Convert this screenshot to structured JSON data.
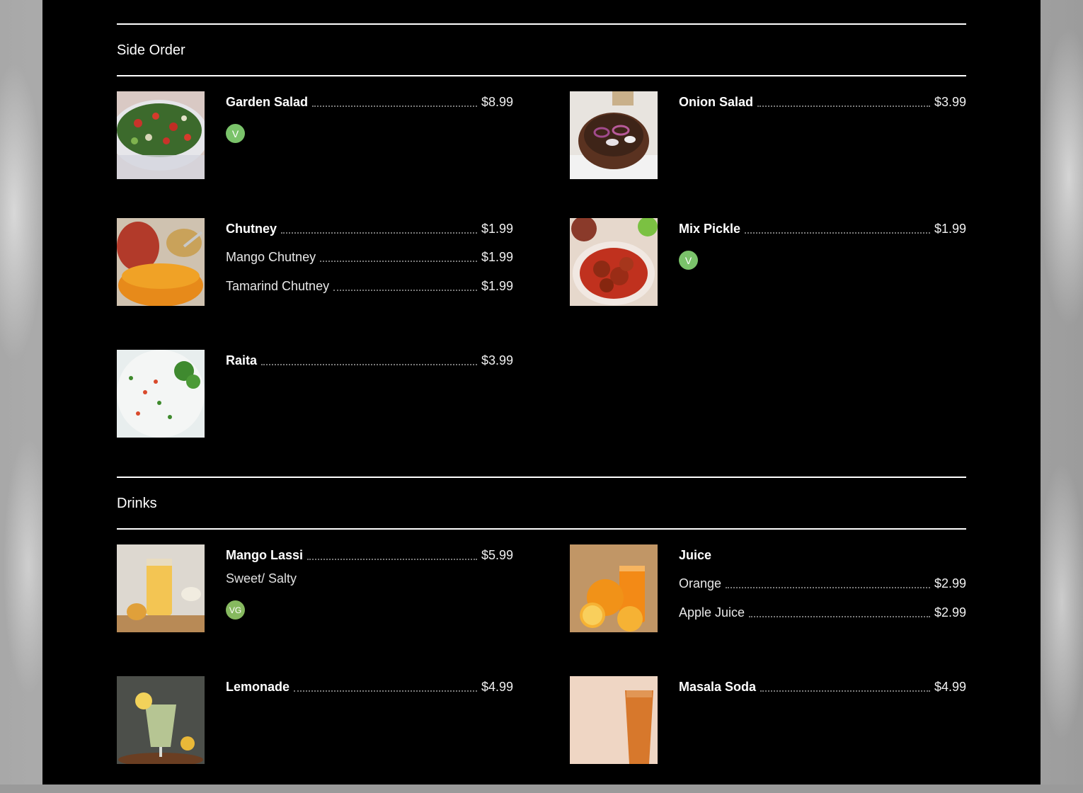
{
  "sections": [
    {
      "title": "Side Order",
      "items": [
        {
          "name": "Garden Salad",
          "price": "$8.99",
          "badge": "V"
        },
        {
          "name": "Onion Salad",
          "price": "$3.99"
        },
        {
          "name": "Chutney",
          "price": "$1.99",
          "options": [
            {
              "name": "Mango Chutney",
              "price": "$1.99"
            },
            {
              "name": "Tamarind Chutney",
              "price": "$1.99"
            }
          ]
        },
        {
          "name": "Mix Pickle",
          "price": "$1.99",
          "badge": "V"
        },
        {
          "name": "Raita",
          "price": "$3.99"
        }
      ]
    },
    {
      "title": "Drinks",
      "items": [
        {
          "name": "Mango Lassi",
          "price": "$5.99",
          "description": "Sweet/ Salty",
          "badge": "VG"
        },
        {
          "name": "Juice",
          "options": [
            {
              "name": "Orange",
              "price": "$2.99"
            },
            {
              "name": "Apple Juice",
              "price": "$2.99"
            }
          ]
        },
        {
          "name": "Lemonade",
          "price": "$4.99"
        },
        {
          "name": "Masala Soda",
          "price": "$4.99"
        }
      ]
    }
  ],
  "colors": {
    "panel": "#000000",
    "badge_vegetarian": "#7ac36a",
    "badge_vegan": "#86b95f"
  },
  "icons": [
    "garden-salad-photo",
    "onion-salad-photo",
    "chutney-photo",
    "mix-pickle-photo",
    "raita-photo",
    "mango-lassi-photo",
    "juice-photo",
    "lemonade-photo",
    "masala-soda-photo"
  ]
}
